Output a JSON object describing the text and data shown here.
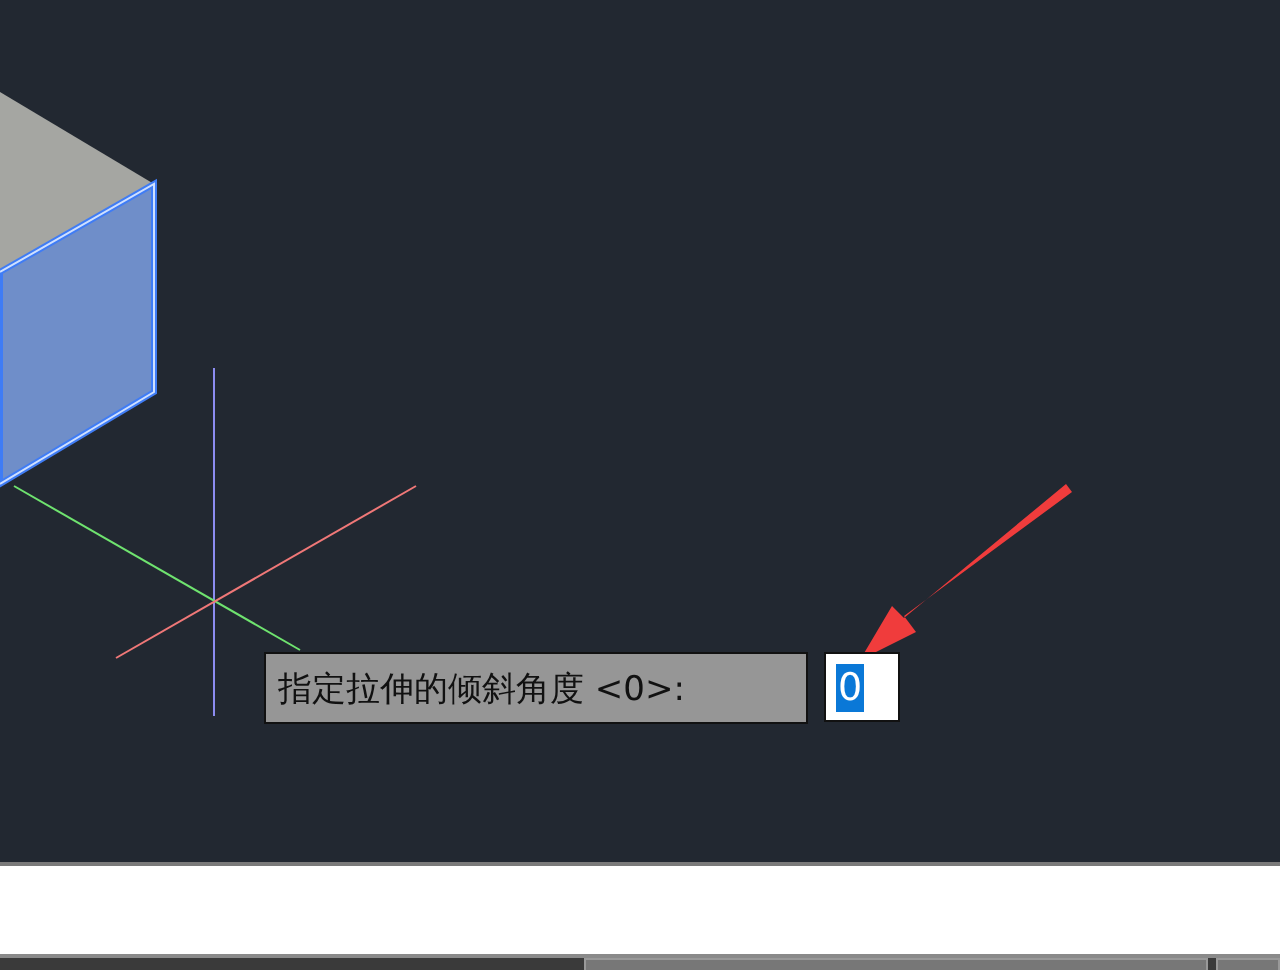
{
  "prompt": {
    "label": "指定拉伸的倾斜角度 <0>:",
    "value": "0",
    "value_selected": true
  }
}
